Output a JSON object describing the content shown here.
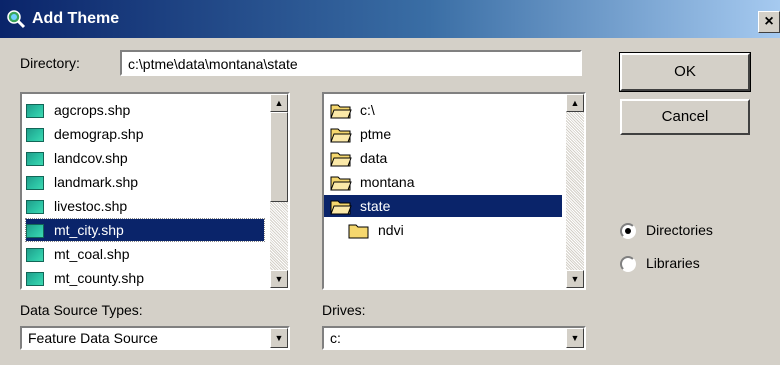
{
  "window": {
    "title": "Add Theme",
    "close_glyph": "×",
    "icon": "globe-magnifier-icon"
  },
  "directory": {
    "label": "Directory:",
    "value": "c:\\ptme\\data\\montana\\state"
  },
  "buttons": {
    "ok": "OK",
    "cancel": "Cancel"
  },
  "files": {
    "items": [
      "agcrops.shp",
      "demograp.shp",
      "landcov.shp",
      "landmark.shp",
      "livestoc.shp",
      "mt_city.shp",
      "mt_coal.shp",
      "mt_county.shp"
    ],
    "selected": "mt_city.shp"
  },
  "folders": {
    "items": [
      "c:\\",
      "ptme",
      "data",
      "montana",
      "state",
      "ndvi"
    ],
    "selected": "state"
  },
  "data_source": {
    "label": "Data Source Types:",
    "value": "Feature Data Source"
  },
  "drives": {
    "label": "Drives:",
    "value": "c:"
  },
  "radio": {
    "directories": "Directories",
    "libraries": "Libraries",
    "selected": "Directories"
  },
  "colors": {
    "selection": "#0a246a",
    "dialog_bg": "#d4d0c8",
    "shapefile_icon": "#2cc4a5",
    "folder": "#f5d76e"
  }
}
